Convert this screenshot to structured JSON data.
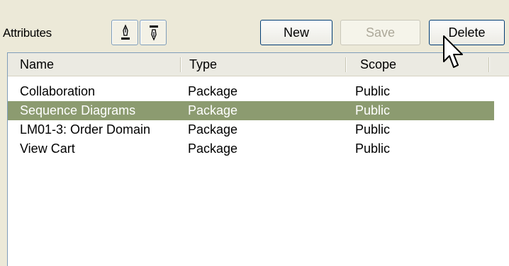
{
  "toolbar": {
    "label": "Attributes",
    "icons": [
      "pen-up-icon",
      "pen-down-icon"
    ],
    "new_label": "New",
    "save_label": "Save",
    "delete_label": "Delete"
  },
  "table": {
    "columns": [
      "Name",
      "Type",
      "Scope"
    ],
    "rows": [
      {
        "name": "Collaboration",
        "type": "Package",
        "scope": "Public"
      },
      {
        "name": "Sequence Diagrams",
        "type": "Package",
        "scope": "Public"
      },
      {
        "name": "LM01-3: Order Domain",
        "type": "Package",
        "scope": "Public"
      },
      {
        "name": "View Cart",
        "type": "Package",
        "scope": "Public"
      }
    ],
    "selected_row": 1
  },
  "colors": {
    "background": "#ECE9D8",
    "selection": "#8C9B70",
    "button_border": "#003C74",
    "disabled_text": "#ACA899"
  }
}
